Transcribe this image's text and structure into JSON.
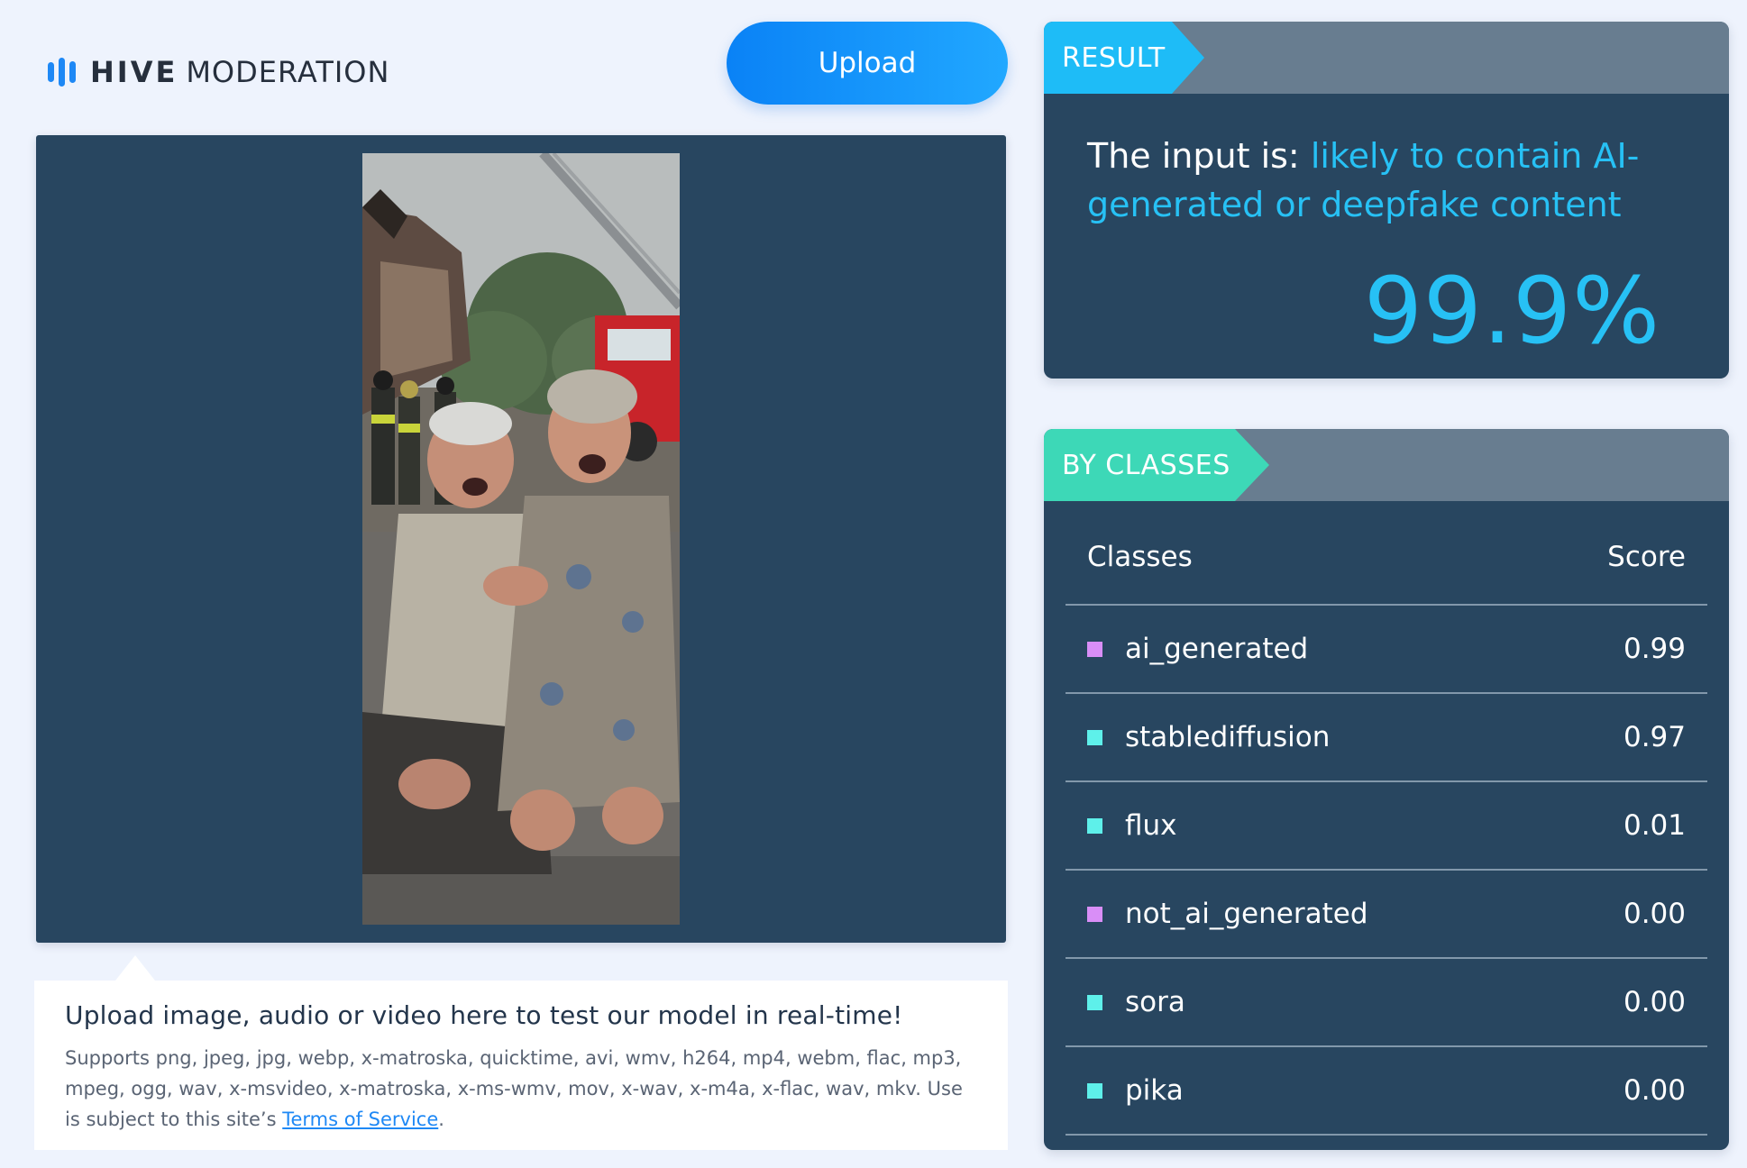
{
  "header": {
    "logo_bold": "HIVE",
    "logo_light": "MODERATION",
    "upload_label": "Upload"
  },
  "info": {
    "title": "Upload image, audio or video here to test our model in real-time!",
    "text_prefix": "Supports png, jpeg, jpg, webp, x-matroska, quicktime, avi, wmv, h264, mp4, webm, flac, mp3, mpeg, ogg, wav, x-msvideo, x-matroska, x-ms-wmv, mov, x-wav, x-m4a, x-flac, wav, mkv. Use is subject to this site’s ",
    "terms_link": "Terms of Service",
    "text_suffix": "."
  },
  "result": {
    "tag": "RESULT",
    "prefix": "The input is: ",
    "verdict": "likely to contain AI-generated or deepfake content",
    "score": "99.9%"
  },
  "classes": {
    "tag": "BY CLASSES",
    "col_class": "Classes",
    "col_score": "Score",
    "rows": [
      {
        "name": "ai_generated",
        "score": "0.99",
        "color": "#d98ef7"
      },
      {
        "name": "stablediffusion",
        "score": "0.97",
        "color": "#5ef0ea"
      },
      {
        "name": "flux",
        "score": "0.01",
        "color": "#5ef0ea"
      },
      {
        "name": "not_ai_generated",
        "score": "0.00",
        "color": "#d98ef7"
      },
      {
        "name": "sora",
        "score": "0.00",
        "color": "#5ef0ea"
      },
      {
        "name": "pika",
        "score": "0.00",
        "color": "#5ef0ea"
      }
    ]
  },
  "colors": {
    "accent_blue": "#1e88f5",
    "panel_dark": "#284660",
    "result_tag": "#1ebcf7",
    "classes_tag": "#3dd8b7"
  }
}
